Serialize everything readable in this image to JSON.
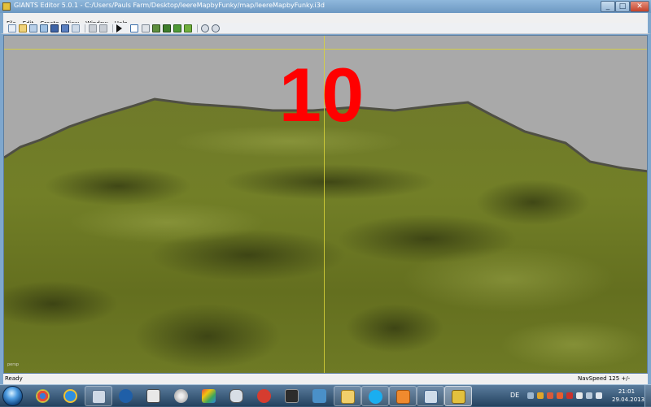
{
  "window": {
    "title": "GIANTS Editor 5.0.1 - C:/Users/Pauls Farm/Desktop/leereMapbyFunky/map/leereMapbyFunky.i3d",
    "minimize_glyph": "_",
    "maximize_glyph": "□",
    "close_glyph": "✕"
  },
  "menu": [
    "File",
    "Edit",
    "Create",
    "View",
    "Window",
    "Help"
  ],
  "toolbar_icons": [
    "new-file-icon",
    "open-folder-icon",
    "open-file-icon",
    "reload-icon",
    "save-icon",
    "save-as-icon",
    "import-icon",
    "undo-icon",
    "redo-icon",
    "play-icon",
    "select-icon",
    "move-icon",
    "terrain-sculpt-icon",
    "terrain-paint-icon",
    "foliage-paint-icon",
    "foliage-icon",
    "settings-icon",
    "navigation-icon"
  ],
  "viewport": {
    "countdown": "10",
    "camera_label": "persp"
  },
  "statusbar": {
    "status": "Ready",
    "nav_speed": "NavSpeed 125 +/-"
  },
  "taskbar": {
    "apps": [
      "chrome-icon",
      "internet-explorer-icon",
      "calculator-icon",
      "media-player-icon",
      "game-controller-icon",
      "disc-icon",
      "paint-icon",
      "mouse-icon",
      "dvd-icon",
      "editor-icon",
      "folder-icon",
      "skype-icon",
      "mail-icon",
      "window-icon",
      "giants-editor-icon"
    ],
    "language": "DE",
    "time": "21:01",
    "date": "29.04.2013"
  },
  "colors": {
    "countdown": "#ff0000",
    "terrain": "#6d7a23",
    "sky": "#a9a9a9"
  }
}
